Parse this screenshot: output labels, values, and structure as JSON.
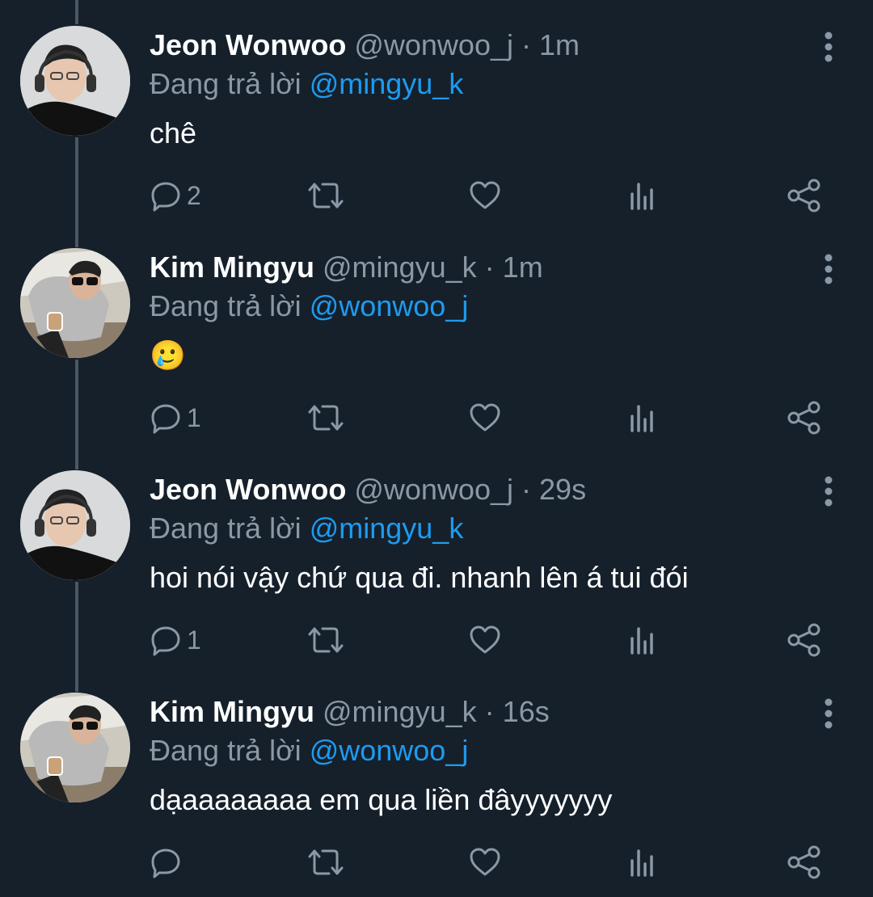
{
  "tweets": [
    {
      "name": "Jeon Wonwoo",
      "handle": "@wonwoo_j",
      "separator": "·",
      "time": "1m",
      "reply_prefix": "Đang trả lời",
      "reply_to": "@mingyu_k",
      "text": "chê",
      "reply_count": "2",
      "avatar_icon": "person-with-headphones-avatar"
    },
    {
      "name": "Kim Mingyu",
      "handle": "@mingyu_k",
      "separator": "·",
      "time": "1m",
      "reply_prefix": "Đang trả lời",
      "reply_to": "@wonwoo_j",
      "text": "🥲",
      "reply_count": "1",
      "avatar_icon": "person-with-sunglasses-avatar"
    },
    {
      "name": "Jeon Wonwoo",
      "handle": "@wonwoo_j",
      "separator": "·",
      "time": "29s",
      "reply_prefix": "Đang trả lời",
      "reply_to": "@mingyu_k",
      "text": "hoi nói vậy chứ qua đi. nhanh lên á tui đói",
      "reply_count": "1",
      "avatar_icon": "person-with-headphones-avatar"
    },
    {
      "name": "Kim Mingyu",
      "handle": "@mingyu_k",
      "separator": "·",
      "time": "16s",
      "reply_prefix": "Đang trả lời",
      "reply_to": "@wonwoo_j",
      "text": "dạaaaaaaaa em qua liền đâyyyyyyy",
      "reply_count": "",
      "avatar_icon": "person-with-sunglasses-avatar"
    }
  ],
  "colors": {
    "background": "#15202b",
    "text_primary": "#ffffff",
    "text_secondary": "#8b98a5",
    "link": "#1d9bf0",
    "thread_line": "#4a5866"
  },
  "icons": {
    "reply": "reply-icon",
    "retweet": "retweet-icon",
    "like": "heart-icon",
    "views": "views-icon",
    "share": "share-icon",
    "more": "more-options-icon"
  }
}
